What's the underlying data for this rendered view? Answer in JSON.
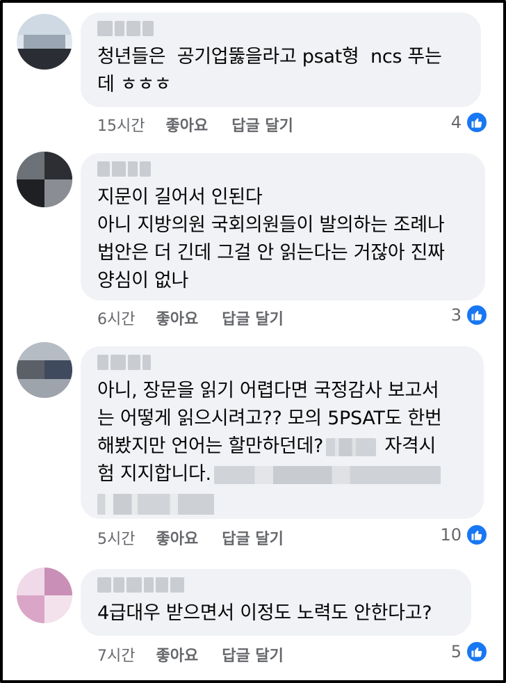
{
  "comments": [
    {
      "text": "청년들은  공기업뚫을라고 psat형  ncs 푸는\n데 ㅎㅎㅎ",
      "time": "15시간",
      "like_label": "좋아요",
      "reply_label": "답글 달기",
      "reaction_count": "4"
    },
    {
      "text": "지문이 길어서 인된다\n아니 지방의원 국회의원들이 발의하는 조례나\n법안은 더 긴데 그걸 안 읽는다는 거잖아 진짜\n양심이 없나",
      "time": "6시간",
      "like_label": "좋아요",
      "reply_label": "답글 달기",
      "reaction_count": "3"
    },
    {
      "text_1": "아니, 장문을 읽기 어렵다면 국정감사 보고서\n는 어떻게 읽으시려고?? 모의 5PSAT도 한번\n해봤지만 언어는 할만하던데?",
      "text_2": " 자격시\n험 지지합니다.",
      "time": "5시간",
      "like_label": "좋아요",
      "reply_label": "답글 달기",
      "reaction_count": "10"
    },
    {
      "text": "4급대우 받으면서 이정도 노력도 안한다고?",
      "time": "7시간",
      "like_label": "좋아요",
      "reply_label": "답글 달기",
      "reaction_count": "5"
    }
  ],
  "colors": {
    "bubble": "#f0f2f5",
    "meta_text": "#65676b",
    "like_blue": "#1877f2"
  },
  "icons": {
    "reaction": "thumbs-up-icon"
  }
}
